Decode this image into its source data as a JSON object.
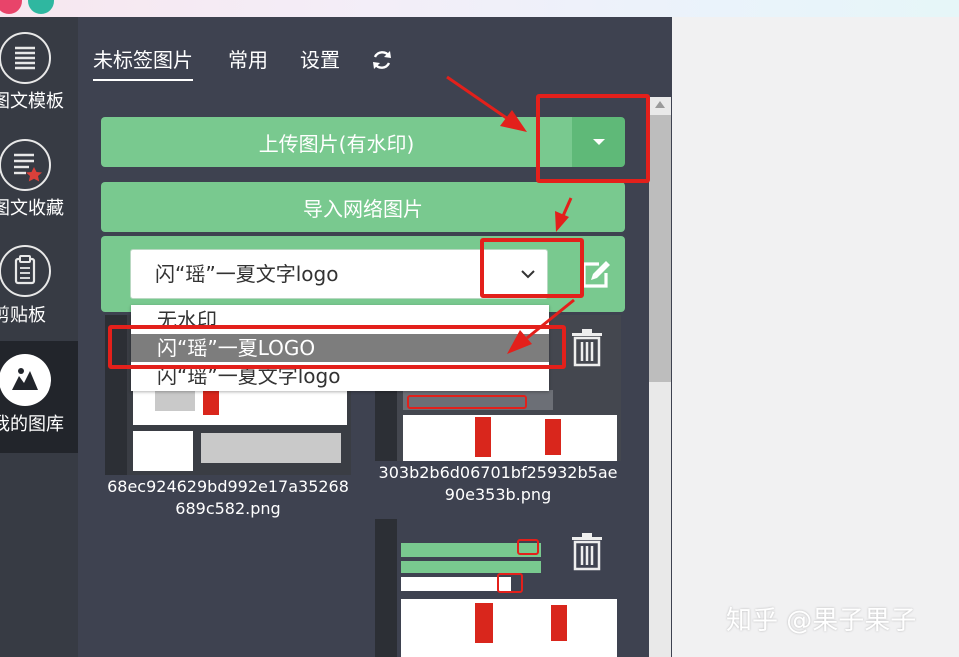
{
  "nav": {
    "items": [
      {
        "label": "图文模板",
        "icon": "list-icon"
      },
      {
        "label": "图文收藏",
        "icon": "star-doc-icon"
      },
      {
        "label": "剪贴板",
        "icon": "clipboard-icon"
      },
      {
        "label": "我的图库",
        "icon": "mountain-icon"
      }
    ]
  },
  "tabs": [
    {
      "label": "未标签图片",
      "active": true
    },
    {
      "label": "常用",
      "active": false
    },
    {
      "label": "设置",
      "active": false
    }
  ],
  "buttons": {
    "upload": "上传图片(有水印)",
    "import": "导入网络图片"
  },
  "watermark_select": {
    "value": "闪“瑶”一夏文字logo",
    "options": [
      "无水印",
      "闪“瑶”一夏LOGO",
      "闪“瑶”一夏文字logo"
    ],
    "highlighted": "闪“瑶”一夏LOGO"
  },
  "gallery": {
    "files": [
      {
        "name": "68ec924629bd992e17a35268689c582.png"
      },
      {
        "name": "303b2b6d06701bf25932b5ae90e353b.png"
      }
    ]
  },
  "watermark_text": "知乎 @果子果子",
  "colors": {
    "accent_green": "#79c98f",
    "annotation_red": "#e3201b",
    "panel_bg": "#3e4250"
  }
}
